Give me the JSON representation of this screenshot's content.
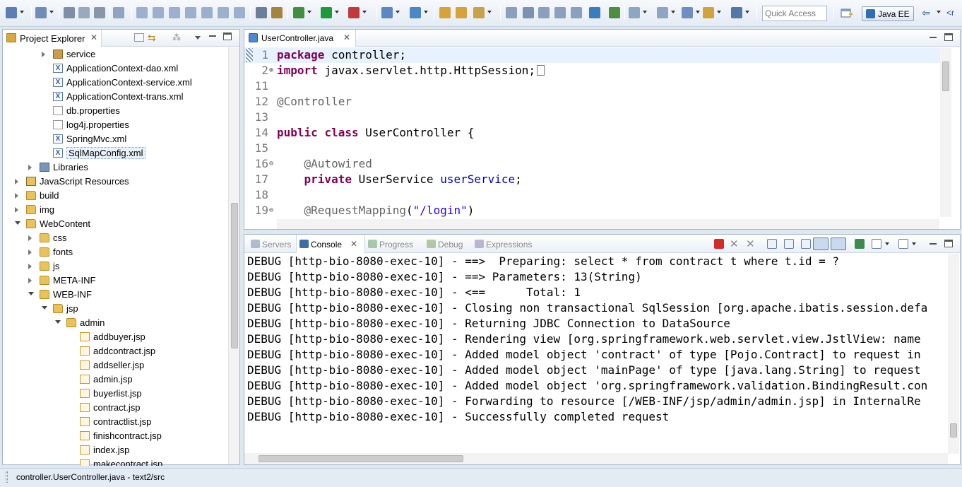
{
  "toolbar": {
    "quick_access_placeholder": "Quick Access",
    "perspective_label": "Java EE",
    "trailing_text": "<r"
  },
  "explorer": {
    "title": "Project Explorer",
    "close_glyph": "✕",
    "items": [
      {
        "label": "service",
        "icon": "package-icon",
        "twisty": "closed"
      },
      {
        "label": "ApplicationContext-dao.xml",
        "icon": "xml-file-icon"
      },
      {
        "label": "ApplicationContext-service.xml",
        "icon": "xml-file-icon"
      },
      {
        "label": "ApplicationContext-trans.xml",
        "icon": "xml-file-icon"
      },
      {
        "label": "db.properties",
        "icon": "properties-file-icon"
      },
      {
        "label": "log4j.properties",
        "icon": "properties-file-icon"
      },
      {
        "label": "SpringMvc.xml",
        "icon": "xml-file-icon"
      },
      {
        "label": "SqlMapConfig.xml",
        "icon": "xml-file-icon",
        "selected": true
      },
      {
        "label": "Libraries",
        "icon": "library-icon",
        "twisty": "closed"
      },
      {
        "label": "JavaScript Resources",
        "icon": "js-resources-icon",
        "twisty": "closed"
      },
      {
        "label": "build",
        "icon": "folder-icon",
        "twisty": "closed"
      },
      {
        "label": "img",
        "icon": "folder-icon",
        "twisty": "closed"
      },
      {
        "label": "WebContent",
        "icon": "folder-icon",
        "twisty": "open"
      },
      {
        "label": "css",
        "icon": "folder-icon",
        "twisty": "closed"
      },
      {
        "label": "fonts",
        "icon": "folder-icon",
        "twisty": "closed"
      },
      {
        "label": "js",
        "icon": "folder-icon",
        "twisty": "closed"
      },
      {
        "label": "META-INF",
        "icon": "folder-icon",
        "twisty": "closed"
      },
      {
        "label": "WEB-INF",
        "icon": "folder-icon",
        "twisty": "open"
      },
      {
        "label": "jsp",
        "icon": "folder-icon",
        "twisty": "open"
      },
      {
        "label": "admin",
        "icon": "folder-icon",
        "twisty": "open"
      },
      {
        "label": "addbuyer.jsp",
        "icon": "jsp-file-icon"
      },
      {
        "label": "addcontract.jsp",
        "icon": "jsp-file-icon"
      },
      {
        "label": "addseller.jsp",
        "icon": "jsp-file-icon"
      },
      {
        "label": "admin.jsp",
        "icon": "jsp-file-icon"
      },
      {
        "label": "buyerlist.jsp",
        "icon": "jsp-file-icon"
      },
      {
        "label": "contract.jsp",
        "icon": "jsp-file-icon"
      },
      {
        "label": "contractlist.jsp",
        "icon": "jsp-file-icon"
      },
      {
        "label": "finishcontract.jsp",
        "icon": "jsp-file-icon"
      },
      {
        "label": "index.jsp",
        "icon": "jsp-file-icon"
      },
      {
        "label": "makecontract.jsp",
        "icon": "jsp-file-icon"
      }
    ]
  },
  "editor": {
    "tab_label": "UserController.java",
    "close_glyph": "✕",
    "lines": [
      {
        "num": "1",
        "tokens": [
          {
            "t": "package",
            "c": "kw"
          },
          {
            "t": " controller;",
            "c": ""
          }
        ],
        "current": true
      },
      {
        "num": "2",
        "fold": "⊕",
        "tokens": [
          {
            "t": "import",
            "c": "kw"
          },
          {
            "t": " javax.servlet.http.HttpSession;",
            "c": ""
          }
        ],
        "collapsed": true
      },
      {
        "num": "11",
        "tokens": []
      },
      {
        "num": "12",
        "tokens": [
          {
            "t": "@Controller",
            "c": "ann"
          }
        ]
      },
      {
        "num": "13",
        "tokens": []
      },
      {
        "num": "14",
        "tokens": [
          {
            "t": "public",
            "c": "kw"
          },
          {
            "t": " ",
            "c": ""
          },
          {
            "t": "class",
            "c": "kw"
          },
          {
            "t": " UserController {",
            "c": ""
          }
        ]
      },
      {
        "num": "15",
        "tokens": []
      },
      {
        "num": "16",
        "fold": "⊖",
        "tokens": [
          {
            "t": "    ",
            "c": ""
          },
          {
            "t": "@Autowired",
            "c": "ann"
          }
        ]
      },
      {
        "num": "17",
        "tokens": [
          {
            "t": "    ",
            "c": ""
          },
          {
            "t": "private",
            "c": "kw"
          },
          {
            "t": " UserService ",
            "c": ""
          },
          {
            "t": "userService",
            "c": "fld"
          },
          {
            "t": ";",
            "c": ""
          }
        ]
      },
      {
        "num": "18",
        "tokens": []
      },
      {
        "num": "19",
        "fold": "⊖",
        "tokens": [
          {
            "t": "    ",
            "c": ""
          },
          {
            "t": "@RequestMapping",
            "c": "ann"
          },
          {
            "t": "(",
            "c": ""
          },
          {
            "t": "\"/login\"",
            "c": "str"
          },
          {
            "t": ")",
            "c": ""
          }
        ]
      }
    ]
  },
  "console_view": {
    "tabs": [
      {
        "label": "Servers",
        "active": false,
        "icon": "servers-icon",
        "color": "#7a8aa3"
      },
      {
        "label": "Console",
        "active": true,
        "icon": "console-icon",
        "color": "#3b6ea8"
      },
      {
        "label": "Progress",
        "active": false,
        "icon": "progress-icon",
        "color": "#6aa36a"
      },
      {
        "label": "Debug",
        "active": false,
        "icon": "debug-icon",
        "color": "#7f9f5f"
      },
      {
        "label": "Expressions",
        "active": false,
        "icon": "expressions-icon",
        "color": "#8c7fb3"
      }
    ],
    "close_glyph": "✕",
    "lines": [
      "DEBUG [http-bio-8080-exec-10] - ==>  Preparing: select * from contract t where t.id = ?",
      "DEBUG [http-bio-8080-exec-10] - ==> Parameters: 13(String)",
      "DEBUG [http-bio-8080-exec-10] - <==      Total: 1",
      "DEBUG [http-bio-8080-exec-10] - Closing non transactional SqlSession [org.apache.ibatis.session.defa",
      "DEBUG [http-bio-8080-exec-10] - Returning JDBC Connection to DataSource",
      "DEBUG [http-bio-8080-exec-10] - Rendering view [org.springframework.web.servlet.view.JstlView: name",
      "DEBUG [http-bio-8080-exec-10] - Added model object 'contract' of type [Pojo.Contract] to request in",
      "DEBUG [http-bio-8080-exec-10] - Added model object 'mainPage' of type [java.lang.String] to request",
      "DEBUG [http-bio-8080-exec-10] - Added model object 'org.springframework.validation.BindingResult.con",
      "DEBUG [http-bio-8080-exec-10] - Forwarding to resource [/WEB-INF/jsp/admin/admin.jsp] in InternalRe",
      "DEBUG [http-bio-8080-exec-10] - Successfully completed request"
    ]
  },
  "statusbar": {
    "text": "controller.UserController.java - text2/src"
  },
  "colors": {
    "keyword": "#7f0055",
    "annotation": "#646464",
    "field": "#0000c0",
    "string": "#2a00ff",
    "current_line": "#e8f2fe"
  }
}
